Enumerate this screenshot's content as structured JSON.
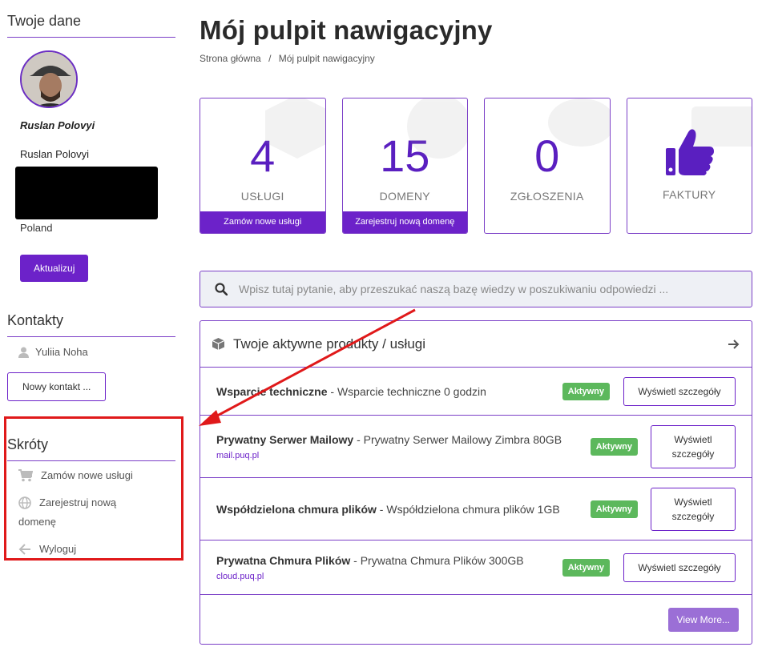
{
  "sidebar": {
    "profile": {
      "title": "Twoje dane",
      "name_bold": "Ruslan Polovyi",
      "name": "Ruslan Polovyi",
      "country": "Poland",
      "update_label": "Aktualizuj"
    },
    "contacts": {
      "title": "Kontakty",
      "items": [
        {
          "label": "Yuliia Noha",
          "icon": "user-icon"
        }
      ],
      "new_contact_label": "Nowy kontakt ..."
    },
    "shortcuts": {
      "title": "Skróty",
      "items": [
        {
          "label": "Zamów nowe usługi",
          "icon": "cart-icon"
        },
        {
          "label_line1": "Zarejestruj nową",
          "label_line2": "domenę",
          "icon": "globe-icon"
        },
        {
          "label": "Wyloguj",
          "icon": "arrow-left-icon"
        }
      ]
    }
  },
  "main": {
    "title": "Mój pulpit nawigacyjny",
    "breadcrumb": {
      "home": "Strona główna",
      "separator": "/",
      "current": "Mój pulpit nawigacyjny"
    },
    "tiles": [
      {
        "value": "4",
        "label": "USŁUGI",
        "footer": "Zamów nowe usługi",
        "icon": "cube-icon"
      },
      {
        "value": "15",
        "label": "DOMENY",
        "footer": "Zarejestruj nową domenę",
        "icon": "globe-icon"
      },
      {
        "value": "0",
        "label": "ZGŁOSZENIA",
        "icon": "comments-icon"
      },
      {
        "label": "FAKTURY",
        "icon": "thumbs-up-icon"
      }
    ],
    "search": {
      "placeholder": "Wpisz tutaj pytanie, aby przeszukać naszą bazę wiedzy w poszukiwaniu odpowiedzi ..."
    },
    "products": {
      "title": "Twoje aktywne produkty / usługi",
      "rows": [
        {
          "name": "Wsparcie techniczne",
          "desc": " - Wsparcie techniczne 0 godzin",
          "domain": "",
          "status": "Aktywny",
          "button": "Wyświetl szczegóły"
        },
        {
          "name": "Prywatny Serwer Mailowy",
          "desc": " - Prywatny Serwer Mailowy Zimbra 80GB",
          "domain": "mail.puq.pl",
          "status": "Aktywny",
          "button_line1": "Wyświetl",
          "button_line2": "szczegóły"
        },
        {
          "name": "Współdzielona chmura plików",
          "desc": " - Współdzielona chmura plików 1GB",
          "domain": "",
          "status": "Aktywny",
          "button_line1": "Wyświetl",
          "button_line2": "szczegóły"
        },
        {
          "name": "Prywatna Chmura Plików",
          "desc": " - Prywatna Chmura Plików 300GB",
          "domain": "cloud.puq.pl",
          "status": "Aktywny",
          "button": "Wyświetl szczegóły"
        }
      ],
      "more_label": "View More..."
    }
  },
  "colors": {
    "accent": "#6c22c9",
    "status_active": "#5cb85c",
    "annotation": "#e0191a"
  }
}
